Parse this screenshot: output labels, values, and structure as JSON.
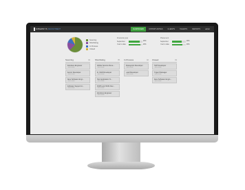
{
  "app": {
    "logo_text": "CIBERSYS",
    "logo_tag": "RECRUITMENT"
  },
  "nav": {
    "items": [
      "DASHBOARD",
      "OPPORTUNITIES",
      "CLIENTS",
      "TALENTS",
      "REPORTS",
      "admin"
    ],
    "active_index": 0
  },
  "colors": {
    "accent_green": "#3fa73f",
    "pie": [
      "#6b8e3a",
      "#8a4f9e",
      "#3f6fbf",
      "#d4b43a"
    ]
  },
  "summary": {
    "pie_fractions": [
      0.62,
      0.18,
      0.12,
      0.08
    ],
    "legend": [
      "Sourcing",
      "Shortlisting",
      "In Process",
      "Closed"
    ],
    "metric_groups": [
      {
        "title": "Financial year",
        "rows": [
          {
            "name": "September",
            "fraction": 0.8,
            "value": "##%"
          },
          {
            "name": "Year to date",
            "fraction": 0.85,
            "value": "##%"
          }
        ]
      },
      {
        "title": "Placement",
        "rows": [
          {
            "name": "September",
            "fraction": 0.7,
            "value": "##%"
          },
          {
            "name": "Year to date",
            "fraction": 0.75,
            "value": "##%"
          }
        ]
      }
    ]
  },
  "board": {
    "columns": [
      {
        "title": "Sourcing",
        "count": "04",
        "cards": [
          {
            "title": "Solutions Engineer",
            "sub": "Client name"
          },
          {
            "title": "Senior Developer",
            "sub": "Client name"
          },
          {
            "title": "Java Software Engi...",
            "sub": "Client name"
          },
          {
            "title": "Software Support A...",
            "sub": "Client name"
          }
        ]
      },
      {
        "title": "Shortlisting",
        "count": "05",
        "cards": [
          {
            "title": "Mobile Service Deve...",
            "sub": "Client name"
          },
          {
            "title": "Sr. FED Developer",
            "sub": "Client name"
          },
          {
            "title": ".Net Application S...",
            "sub": "Client name"
          },
          {
            "title": "SSRS and SSIS Dev...",
            "sub": "Client name"
          },
          {
            "title": "Solutions Engineer",
            "sub": "Client name"
          }
        ]
      },
      {
        "title": "In Process",
        "count": "02",
        "cards": [
          {
            "title": "Sharepoint Developer",
            "sub": "Client name"
          },
          {
            "title": "Lead Developer",
            "sub": "Client name"
          }
        ]
      },
      {
        "title": "Closed",
        "count": "03",
        "cards": [
          {
            "title": "PHP Developer",
            "sub": "Client name"
          },
          {
            "title": "Project Manager",
            "sub": "Client name"
          },
          {
            "title": "Java Software Engin...",
            "sub": "Client name"
          }
        ]
      }
    ]
  }
}
